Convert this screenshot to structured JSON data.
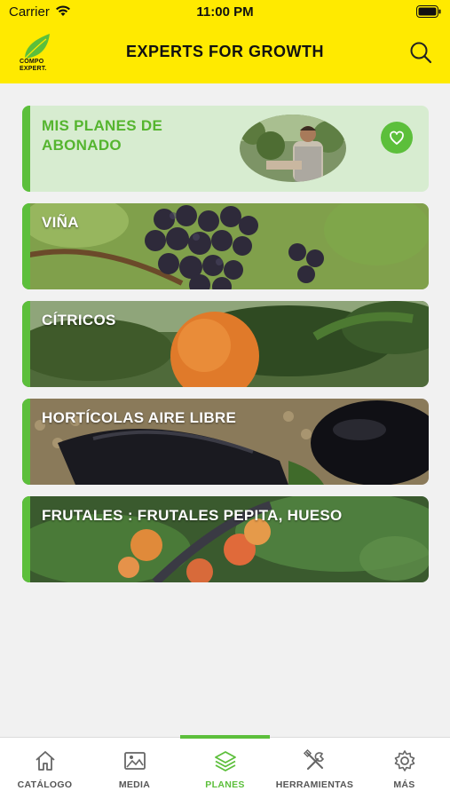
{
  "status_bar": {
    "carrier": "Carrier",
    "time": "11:00 PM"
  },
  "header": {
    "logo_text_line1": "COMPO",
    "logo_text_line2": "EXPERT.",
    "title": "EXPERTS FOR GROWTH",
    "search_icon": "search-icon"
  },
  "cards": [
    {
      "label": "MIS PLANES DE ABONADO",
      "icon": "heart-icon"
    },
    {
      "label": "VIÑA"
    },
    {
      "label": "CÍTRICOS"
    },
    {
      "label": "HORTÍCOLAS AIRE LIBRE"
    },
    {
      "label": "FRUTALES : FRUTALES PEPITA, HUESO"
    }
  ],
  "tabs": [
    {
      "label": "CATÁLOGO",
      "icon": "home-icon"
    },
    {
      "label": "MEDIA",
      "icon": "image-icon"
    },
    {
      "label": "PLANES",
      "icon": "layers-icon",
      "active": true
    },
    {
      "label": "HERRAMIENTAS",
      "icon": "tools-icon"
    },
    {
      "label": "MÁS",
      "icon": "gear-icon"
    }
  ],
  "colors": {
    "header_bg": "#ffea00",
    "accent_green": "#5cbf3b",
    "plans_card_bg": "#d7ecd0"
  }
}
